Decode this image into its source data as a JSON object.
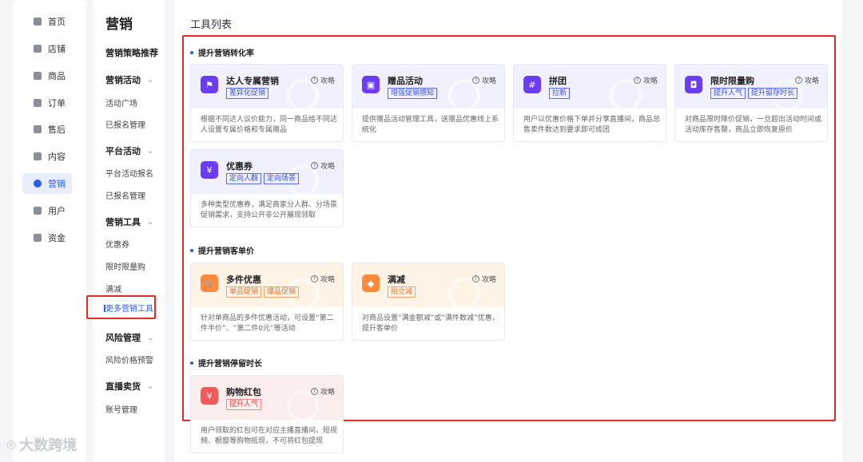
{
  "nav": {
    "items": [
      {
        "label": "首页",
        "icon": "home-icon"
      },
      {
        "label": "店铺",
        "icon": "store-icon"
      },
      {
        "label": "商品",
        "icon": "product-icon"
      },
      {
        "label": "订单",
        "icon": "order-icon"
      },
      {
        "label": "售后",
        "icon": "aftersale-icon"
      },
      {
        "label": "内容",
        "icon": "content-icon"
      },
      {
        "label": "营销",
        "icon": "marketing-icon"
      },
      {
        "label": "用户",
        "icon": "user-icon"
      },
      {
        "label": "资金",
        "icon": "wallet-icon"
      }
    ],
    "active": "营销"
  },
  "menu": {
    "title": "营销",
    "strategy": "营销策略推荐",
    "groups": [
      {
        "label": "营销活动",
        "items": [
          "活动广场",
          "已报名管理"
        ]
      },
      {
        "label": "平台活动",
        "items": [
          "平台活动报名",
          "已报名管理"
        ]
      },
      {
        "label": "营销工具",
        "items": [
          "优惠券",
          "限时限量购",
          "满减",
          "更多营销工具"
        ]
      },
      {
        "label": "风险管理",
        "items": [
          "风险价格预警"
        ]
      },
      {
        "label": "直播卖货",
        "items": [
          "账号管理"
        ]
      }
    ],
    "selected": "更多营销工具"
  },
  "main": {
    "title": "工具列表",
    "guide_label": "攻略",
    "sections": [
      {
        "title": "提升营销转化率",
        "cards": [
          {
            "name": "达人专属营销",
            "tags": [
              "差异化促销"
            ],
            "desc": "根据不同达人议价能力，同一商品给不同达人设置专属价格和专属赠品",
            "theme": "purple"
          },
          {
            "name": "赠品活动",
            "tags": [
              "增强促销感知"
            ],
            "desc": "提供赠品活动管理工具，送赠品优惠线上系统化",
            "theme": "purple"
          },
          {
            "name": "拼团",
            "tags": [
              "拉新"
            ],
            "desc": "用户以优惠价格下单并分享直播间，商品总售卖件数达到要求即可成团",
            "theme": "purple"
          },
          {
            "name": "限时限量购",
            "tags": [
              "提升人气",
              "提升留存时长"
            ],
            "desc": "对商品限时降价促销，一旦超出活动时间或活动库存售罄，商品立即恢复原价",
            "theme": "purple"
          },
          {
            "name": "优惠券",
            "tags": [
              "定向人群",
              "定向场景"
            ],
            "desc": "多种类型优惠券，满足商家分人群、分场景促销需求，支持公开非公开展现领取",
            "theme": "purple"
          }
        ]
      },
      {
        "title": "提升营销客单价",
        "cards": [
          {
            "name": "多件优惠",
            "tags": [
              "单品促销",
              "爆品促销"
            ],
            "desc": "针对单商品的多件优惠活动，可设置“第二件半价”、“第二件0元”等活动",
            "theme": "orange"
          },
          {
            "name": "满减",
            "tags": [
              "拍立减"
            ],
            "desc": "对商品设置“满金额减”或“满件数减”优惠，提升客单价",
            "theme": "orange"
          }
        ]
      },
      {
        "title": "提升营销停留时长",
        "cards": [
          {
            "name": "购物红包",
            "tags": [
              "提升人气"
            ],
            "desc": "用户领取的红包可在对应主播直播间、短视频、橱窗等购物抵现，不可将红包提现",
            "theme": "pink"
          }
        ]
      }
    ]
  },
  "logo": {
    "text": "大数跨境"
  },
  "colors": {
    "accent": "#2b5ee8",
    "highlight": "#e02b2b"
  }
}
